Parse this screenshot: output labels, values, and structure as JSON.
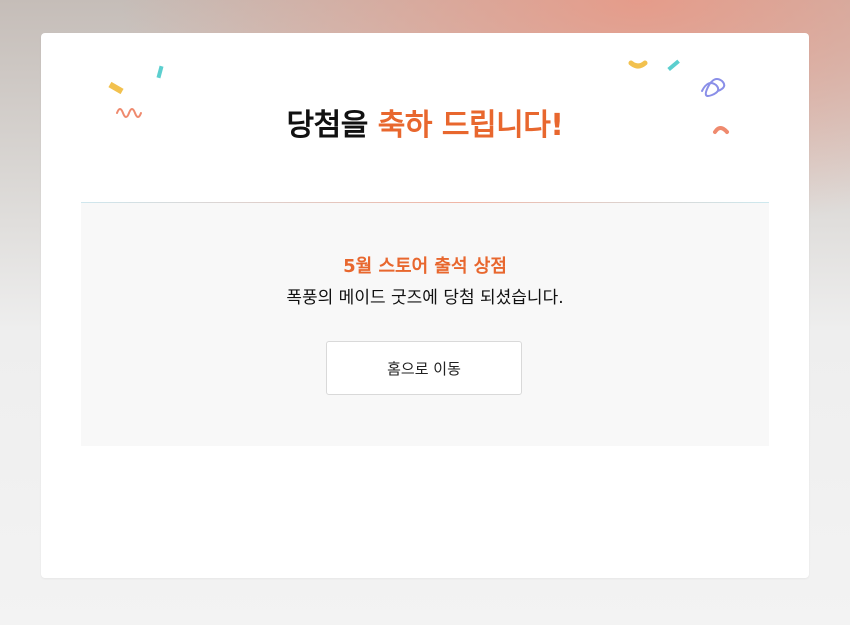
{
  "dialog": {
    "title_part1": "당첨을",
    "title_part2": "축하 드립니다!",
    "event_name": "5월 스토어 출석 상점",
    "message": "폭풍의 메이드 굿즈에 당첨 되셨습니다.",
    "home_button_label": "홈으로 이동"
  },
  "colors": {
    "accent": "#e8672e",
    "confetti_yellow": "#f2c14e",
    "confetti_teal": "#5ccfcf",
    "confetti_coral": "#ef8a6e",
    "confetti_purple": "#8a8fe8"
  }
}
